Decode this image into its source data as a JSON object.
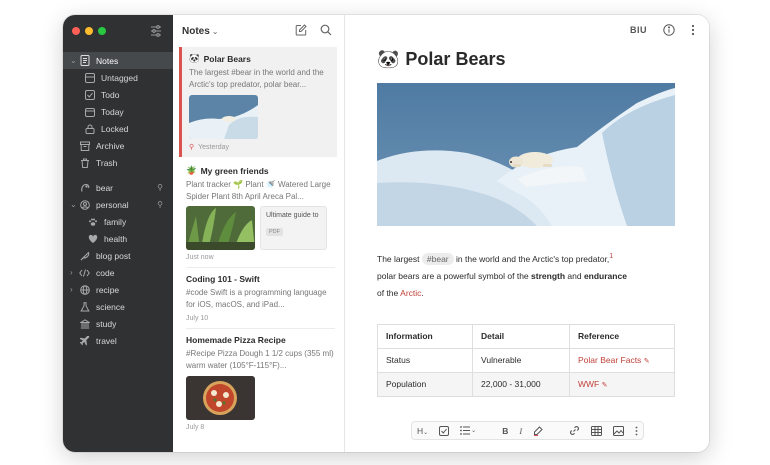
{
  "sidebar": {
    "items": [
      {
        "label": "Notes",
        "icon": "note-icon",
        "expanded": true,
        "active": true
      },
      {
        "label": "Untagged",
        "icon": "untagged-icon"
      },
      {
        "label": "Todo",
        "icon": "checkbox-icon"
      },
      {
        "label": "Today",
        "icon": "calendar-icon"
      },
      {
        "label": "Locked",
        "icon": "lock-icon"
      },
      {
        "label": "Archive",
        "icon": "archive-icon"
      },
      {
        "label": "Trash",
        "icon": "trash-icon"
      }
    ],
    "tags": [
      {
        "label": "bear",
        "icon": "bear-tag-icon",
        "pinned": true
      },
      {
        "label": "personal",
        "icon": "person-tag-icon",
        "pinned": true,
        "expanded": true
      },
      {
        "label": "family",
        "icon": "paw-icon",
        "child": true
      },
      {
        "label": "health",
        "icon": "heart-icon",
        "child": true
      },
      {
        "label": "blog post",
        "icon": "feather-icon"
      },
      {
        "label": "code",
        "icon": "code-icon",
        "collapsed": true
      },
      {
        "label": "recipe",
        "icon": "globe-icon",
        "collapsed": true
      },
      {
        "label": "science",
        "icon": "flask-icon"
      },
      {
        "label": "study",
        "icon": "building-icon"
      },
      {
        "label": "travel",
        "icon": "airplane-icon"
      }
    ]
  },
  "list": {
    "title": "Notes",
    "notes": [
      {
        "title": "Polar Bears",
        "emoji": "🐼",
        "snippet": "The largest #bear in the world and the Arctic's top predator, polar bear...",
        "meta": "Yesterday"
      },
      {
        "title": "My green friends",
        "emoji": "🪴",
        "snippet": "Plant tracker 🌱 Plant 🚿 Watered Large Spider Plant 8th April Areca Pal...",
        "meta": "Just now",
        "attachment_title": "Ultimate guide to",
        "attachment_type": "PDF"
      },
      {
        "title": "Coding 101 - Swift",
        "snippet": "#code Swift is a programming language for iOS, macOS, and iPad...",
        "meta": "July 10"
      },
      {
        "title": "Homemade Pizza Recipe",
        "snippet": "#Recipe Pizza Dough 1 1/2 cups (355 ml) warm water (105°F-115°F)...",
        "meta": "July 8"
      }
    ]
  },
  "editor": {
    "format_label": "BIU",
    "title": "Polar Bears",
    "title_emoji": "🐼",
    "para": {
      "t1": "The largest ",
      "tag": "#bear",
      "t2": " in the world and the Arctic's top predator,",
      "footnote": "1",
      "t3": "polar bears are a powerful symbol of the ",
      "strong1": "strength",
      "t4": " and ",
      "strong2": "endurance",
      "t5": "of the ",
      "link": "Arctic",
      "t6": "."
    },
    "table": {
      "headers": [
        "Information",
        "Detail",
        "Reference"
      ],
      "rows": [
        [
          "Status",
          "Vulnerable",
          "Polar Bear Facts"
        ],
        [
          "Population",
          "22,000 - 31,000",
          "WWF"
        ]
      ]
    },
    "toolbar": {
      "heading": "H",
      "bold": "B",
      "italic": "I"
    }
  },
  "colors": {
    "sidebar_bg": "#2f3133",
    "accent": "#d9534f",
    "link": "#c2413a"
  }
}
